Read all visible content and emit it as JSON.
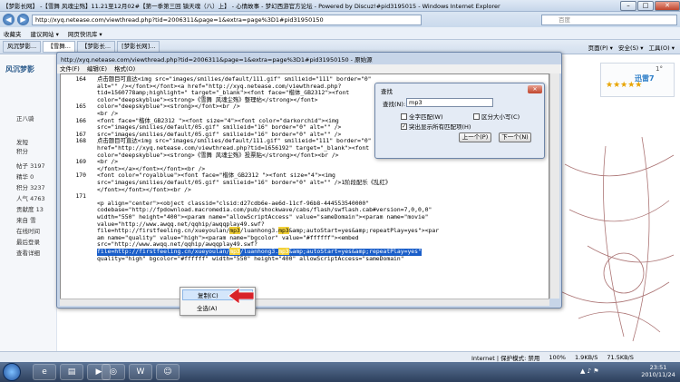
{
  "ie": {
    "title": "【梦影长网】 -【雪舞 风魂尘殇】11.21至12月02#【第一季第三回 镇天魂（八）上】 - 心情故事 - 梦幻西游官方论坛 - Powered by Discuz!#pid3195015 - Windows Internet Explorer",
    "min": "–",
    "max": "□",
    "close": "✕",
    "url": "http://xyq.netease.com/viewthread.php?tid=2006311&page=1&extra=page%3D1#pid31950150",
    "search_placeholder": "百度",
    "favorites": [
      "收藏夹",
      "建议网站 ▾",
      "网页快讯库 ▾"
    ],
    "tabs": [
      "风沉梦影...",
      "【雪舞...",
      "【梦影长...",
      "[梦影长网]..."
    ],
    "commands": [
      "页面(P) ▾",
      "安全(S) ▾",
      "工具(O) ▾"
    ]
  },
  "page": {
    "user_name": "风沉梦影",
    "sidebar_lines": [
      "正八骑",
      "发短",
      "积分",
      "帖子 3197",
      "精华 0",
      "积分 3237",
      "人气 4763",
      "贡献度 13",
      "来自 雪",
      "在线时间",
      "最后登录",
      "查看详细"
    ],
    "page_num": "1°",
    "ad_logo": "迅雷7"
  },
  "notepad": {
    "title": "http://xyq.netease.com/viewthread.php?tid=2006311&page=1&extra=page%3D1#pid31950150 - 原始源",
    "menu": [
      "文件(F)",
      "编辑(E)",
      "格式(O)"
    ],
    "lines": [
      {
        "n": "164",
        "t": "点击题目可直达<img src=\"images/smilies/default/111.gif\" smilieid=\"111\" border=\"0\""
      },
      {
        "n": "",
        "t": "alt=\"\" /></font></font><a href=\"http://xyq.netease.com/viewthread.php?"
      },
      {
        "n": "",
        "t": "tid=1560778amp;highlight=\" target=\"_blank\"><font face=\"楷体_GB2312\"><font"
      },
      {
        "n": "",
        "t": "color=\"deepskyblue\"><strong>《雪舞 风魂尘殇》整理帖</strong></font>"
      },
      {
        "n": "165",
        "t": "color=\"deepskyblue\"><strong></font><br />"
      },
      {
        "n": "",
        "t": "<br />"
      },
      {
        "n": "166",
        "t": "<font face=\"楷体_GB2312 \"><font size=\"4\"><font color=\"darkorchid\"><img"
      },
      {
        "n": "",
        "t": "src=\"images/smilies/default/05.gif\" smilieid=\"16\" border=\"0\" alt=\"\" />"
      },
      {
        "n": "167",
        "t": "src=\"images/smilies/default/05.gif\" smilieid=\"16\" border=\"0\" alt=\"\" />"
      },
      {
        "n": "168",
        "t": "点击题目可直达<img src=\"images/smilies/default/111.gif\" smilieid=\"111\" border=\"0\" alt=\"\" /><a"
      },
      {
        "n": "",
        "t": "href=\"http://xyq.netease.com/viewthread.php?tid=1656192\" target=\"_blank\"><font"
      },
      {
        "n": "",
        "t": "color=\"deepskyblue\"><strong>《雪舞 风魂尘殇》投票贴</strong></font><br />"
      },
      {
        "n": "169",
        "t": "<br />"
      },
      {
        "n": "",
        "t": "</font></a></font></font><br />"
      },
      {
        "n": "170",
        "t": "<font color=\"royalblue\"><font face=\"楷体_GB2312 \"><font size=\"4\"><img"
      },
      {
        "n": "",
        "t": "src=\"images/smilies/default/05.gif\" smilieid=\"16\" border=\"0\" alt=\"\" />1阶段配乐《乱红》"
      },
      {
        "n": "",
        "t": "</font></font></font><br />"
      },
      {
        "n": "171",
        "t": ""
      },
      {
        "n": "",
        "t": "<p align=\"center\"><object classid=\"clsid:d27cdb6e-ae6d-11cf-96b8-444553540000\""
      },
      {
        "n": "",
        "t": "codebase=\"http://fpdownload.macromedia.com/pub/shockwave/cabs/flash/swflash.cab#version=7,0,0,0\""
      },
      {
        "n": "",
        "t": "width=\"550\" height=\"400\"><param name=\"allowScriptAccess\" value=\"sameDomain\"><param name=\"movie\""
      },
      {
        "n": "",
        "t": "value=\"http://www.awqq.net/qqhip/awqqplay49.swf?"
      },
      {
        "n": "",
        "t": "file=http://firstfeeling.cn/xueyoulan/mp3/luanhong3.mp3&amp;autoStart=yes&amp;repeatPlay=yes\"><par"
      },
      {
        "n": "",
        "t": "am name=\"quality\" value=\"high\"><param name=\"bgcolor\" value=\"#ffffff\"><embed"
      },
      {
        "n": "",
        "t": "src=\"http://www.awqq.net/qqhip/awqqplay49.swf?"
      },
      {
        "n": "",
        "t": "file=http://firstfeeling.cn/xueyoulan/mp3/luanhong3.mp3&amp;autoStart=yes&amp;repeatPlay=yes\""
      },
      {
        "n": "",
        "t": "quality=\"high\" bgcolor=\"#ffffff\" width=\"550\" height=\"400\" allowScriptAccess=\"sameDomain\""
      }
    ]
  },
  "find": {
    "title": "查找",
    "label": "查找(N):",
    "value": "mp3",
    "opt_whole": "全字匹配(W)",
    "opt_case": "区分大小写(C)",
    "opt_highlight": "突出显示所有匹配项(H)",
    "prev": "上一个(P)",
    "next": "下一个(N)",
    "close": "✕"
  },
  "context_menu": {
    "copy": "复制(C)",
    "select_all": "全选(A)"
  },
  "status": {
    "zone": "Internet | 保护模式: 禁用",
    "zoom": "100%",
    "up": "1.9KB/S",
    "down": "71.5KB/S"
  },
  "taskbar": {
    "time": "23:51",
    "date": "2010/11/24"
  },
  "colors": {
    "selection": "#1a5ec9",
    "match": "#f3d23a",
    "arrow": "#d8232a"
  }
}
